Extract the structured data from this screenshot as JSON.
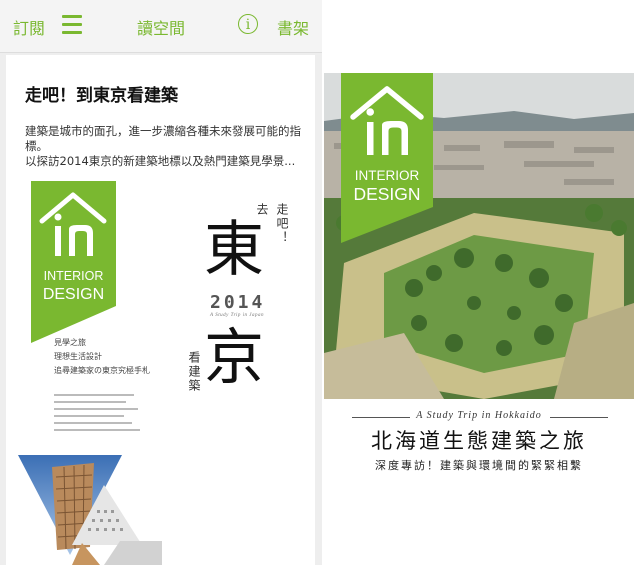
{
  "app": {
    "nav_left": "訂閱",
    "nav_center": "讀空間",
    "nav_right": "書架",
    "info_icon_symbol": "i",
    "accent_color": "#7ab830",
    "icons": [
      "hamburger-menu-icon",
      "info-icon"
    ]
  },
  "article": {
    "title": "走吧！到東京看建築",
    "desc_1": "建築是城市的面孔，進一步濃縮各種未來發展可能的指標。",
    "desc_2": "以探訪2014東京的新建築地標以及熱門建築見學景..."
  },
  "brand": {
    "line1": "INTERIOR",
    "line2": "DESIGN",
    "color": "#7ab830"
  },
  "left_cover": {
    "vert_1": "走吧！",
    "vert_2": "去",
    "char_1": "東",
    "char_2": "京",
    "year": "2014",
    "year_sub": "A Study Trip in Japan",
    "vert_3": "看建築",
    "line_1": "見學之旅",
    "line_2": "理想生活設計",
    "line_3": "追尋建築家の東京究極手札"
  },
  "right_cover": {
    "subtitle": "A Study Trip in Hokkaido",
    "title": "北海道生態建築之旅",
    "tagline": "深度專訪！建築與環境間的緊緊相繫"
  }
}
